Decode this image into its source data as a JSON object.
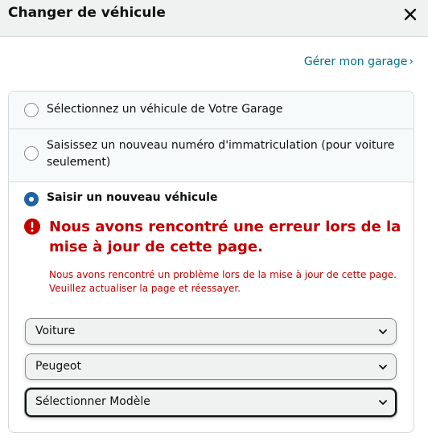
{
  "header": {
    "title": "Changer de véhicule",
    "close_icon": "close-icon"
  },
  "garage_link": {
    "label": "Gérer mon garage",
    "chevron": "›"
  },
  "options": [
    {
      "label": "Sélectionnez un véhicule de Votre Garage",
      "selected": false
    },
    {
      "label": "Saisissez un nouveau numéro d'immatriculation (pour voiture seulement)",
      "selected": false
    },
    {
      "label": "Saisir un nouveau véhicule",
      "selected": true
    }
  ],
  "error": {
    "icon": "error-icon",
    "title": "Nous avons rencontré une erreur lors de la mise à jour de cette page.",
    "message": "Nous avons rencontré un problème lors de la mise à jour de cette page. Veuillez actualiser la page et réessayer."
  },
  "selects": [
    {
      "value": "Voiture"
    },
    {
      "value": "Peugeot"
    },
    {
      "value": "Sélectionner Modèle"
    }
  ],
  "colors": {
    "error": "#c40000",
    "link": "#007185",
    "radio_selected": "#2162a1",
    "header_bg": "#f0f2f2"
  }
}
